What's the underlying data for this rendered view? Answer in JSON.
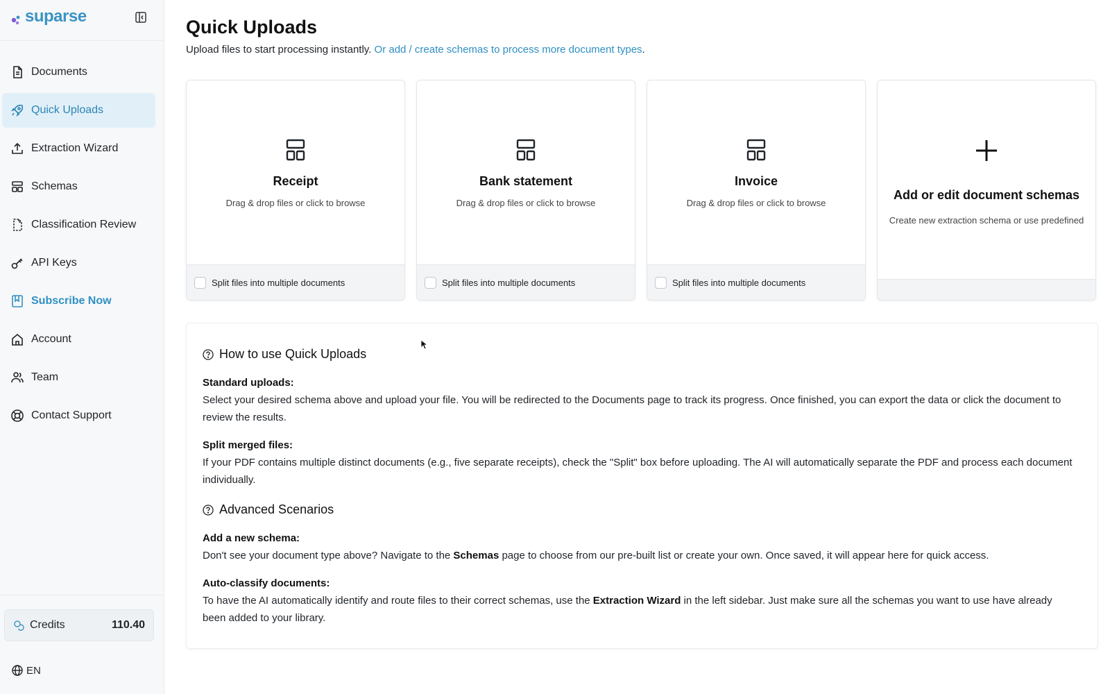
{
  "brand": {
    "name": "suparse"
  },
  "sidebar": {
    "items": [
      {
        "label": "Documents",
        "icon": "document-icon"
      },
      {
        "label": "Quick Uploads",
        "icon": "rocket-icon",
        "active": true
      },
      {
        "label": "Extraction Wizard",
        "icon": "upload-icon"
      },
      {
        "label": "Schemas",
        "icon": "schema-grid-icon"
      },
      {
        "label": "Classification Review",
        "icon": "file-dashed-icon"
      },
      {
        "label": "API Keys",
        "icon": "key-icon"
      },
      {
        "label": "Subscribe Now",
        "icon": "bookmark-icon"
      },
      {
        "label": "Account",
        "icon": "home-icon"
      },
      {
        "label": "Team",
        "icon": "users-icon"
      },
      {
        "label": "Contact Support",
        "icon": "lifebuoy-icon"
      }
    ],
    "credits": {
      "label": "Credits",
      "value": "110.40"
    },
    "language": "EN"
  },
  "page": {
    "title": "Quick Uploads",
    "subtitle_text": "Upload files to start processing instantly. ",
    "subtitle_link": "Or add / create schemas to process more document types",
    "subtitle_end": "."
  },
  "cards": [
    {
      "title": "Receipt",
      "desc": "Drag & drop files or click to browse",
      "split_label": "Split files into multiple documents"
    },
    {
      "title": "Bank statement",
      "desc": "Drag & drop files or click to browse",
      "split_label": "Split files into multiple documents"
    },
    {
      "title": "Invoice",
      "desc": "Drag & drop files or click to browse",
      "split_label": "Split files into multiple documents"
    }
  ],
  "add_card": {
    "title": "Add or edit document schemas",
    "desc": "Create new extraction schema or use predefined"
  },
  "help": {
    "heading": "How to use Quick Uploads",
    "standard_label": "Standard uploads:",
    "standard_text": "Select your desired schema above and upload your file. You will be redirected to the Documents page to track its progress. Once finished, you can export the data or click the document to review the results.",
    "split_label": "Split merged files:",
    "split_text": "If your PDF contains multiple distinct documents (e.g., five separate receipts), check the \"Split\" box before uploading. The AI will automatically separate the PDF and process each document individually.",
    "advanced_heading": "Advanced Scenarios",
    "schema_label": "Add a new schema:",
    "schema_text_1": "Don't see your document type above? Navigate to the ",
    "schema_bold": "Schemas",
    "schema_text_2": " page to choose from our pre-built list or create your own. Once saved, it will appear here for quick access.",
    "classify_label": "Auto-classify documents:",
    "classify_text_1": "To have the AI automatically identify and route files to their correct schemas, use the ",
    "classify_bold": "Extraction Wizard",
    "classify_text_2": " in the left sidebar. Just make sure all the schemas you want to use have already been added to your library."
  },
  "colors": {
    "accent": "#2f8fc4",
    "active_bg": "#e1f0f8",
    "logo_purple": "#7a5bd6"
  }
}
